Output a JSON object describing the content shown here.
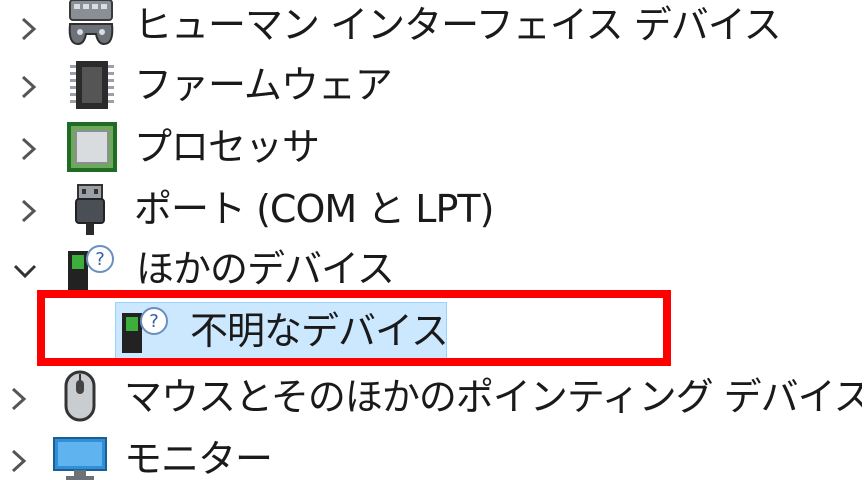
{
  "tree": {
    "items": [
      {
        "label": "ヒューマン インターフェイス デバイス",
        "expanded": false,
        "icon": "hid-icon"
      },
      {
        "label": "ファームウェア",
        "expanded": false,
        "icon": "firmware-chip-icon"
      },
      {
        "label": "プロセッサ",
        "expanded": false,
        "icon": "processor-icon"
      },
      {
        "label": "ポート (COM と LPT)",
        "expanded": false,
        "icon": "port-icon"
      },
      {
        "label": "ほかのデバイス",
        "expanded": true,
        "icon": "unknown-device-icon"
      },
      {
        "label": "不明なデバイス",
        "selected": true,
        "icon": "unknown-device-icon"
      },
      {
        "label": "マウスとそのほかのポインティング デバイス",
        "expanded": false,
        "icon": "mouse-icon"
      },
      {
        "label": "モニター",
        "expanded": false,
        "icon": "monitor-icon"
      }
    ]
  },
  "colors": {
    "selection_bg": "#cce8ff",
    "selection_border": "#99d1ff",
    "highlight_box": "#ff0000",
    "chevron": "#555555"
  }
}
